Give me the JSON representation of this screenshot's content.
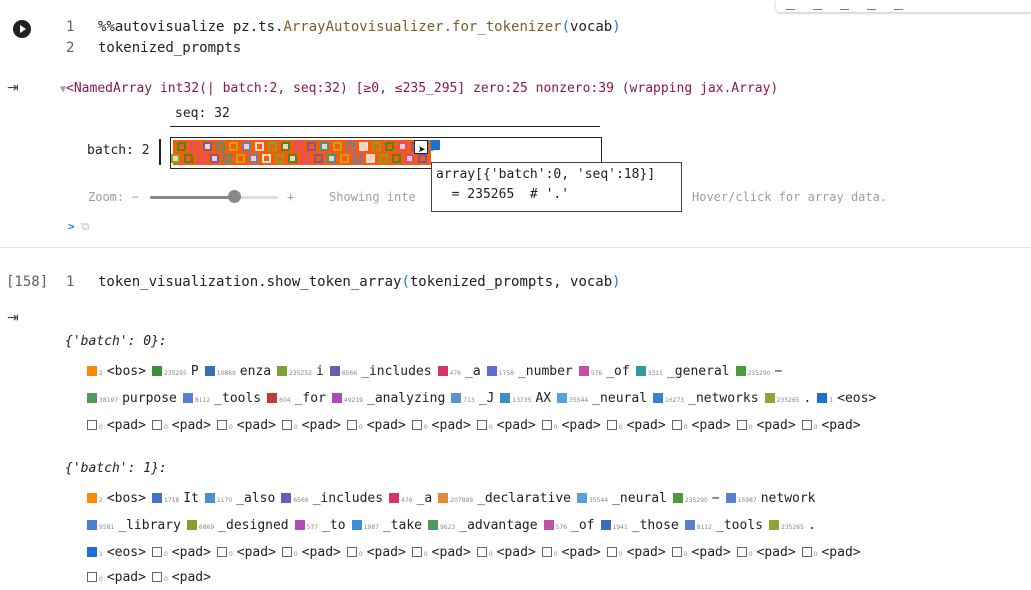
{
  "cell1": {
    "line_numbers": [
      "1",
      "2"
    ],
    "line1_prefix": "%%autovisualize pz.ts.",
    "line1_fn": "ArrayAutovisualizer.for_tokenizer",
    "line1_paren_open": "(",
    "line1_arg": "vocab",
    "line1_paren_close": ")",
    "line2": "tokenized_prompts"
  },
  "output1": {
    "named_array_summary": "<NamedArray int32(| batch:2, seq:32) [≥0, ≤235_295] zero:25 nonzero:39 (wrapping jax.Array)",
    "seq_label": "seq: 32",
    "batch_label": "batch: 2",
    "tooltip_line1": "array[{'batch':0, 'seq':18}]",
    "tooltip_line2": "  = 235265  # '.'",
    "zoom_label": "Zoom: −",
    "zoom_plus": "+",
    "showing_text": "Showing inte",
    "hover_text": "Hover/click for array data.",
    "expand_symbol": ">",
    "zoom_percent": 0.66
  },
  "cell2": {
    "exec_count": "[158]",
    "line_number": "1",
    "code_prefix": "token_visualization.show_token_array",
    "paren_open": "(",
    "code_args": "tokenized_prompts, vocab",
    "paren_close": ")"
  },
  "output2": {
    "batch0_header": "{'batch': 0}:",
    "batch1_header": "{'batch': 1}:",
    "batch0_lines": [
      [
        {
          "c": "#ff8a00",
          "id": "2",
          "t": "<bos>"
        },
        {
          "c": "#3d8f3d",
          "id": "235295",
          "t": "P"
        },
        {
          "c": "#3a6fb8",
          "id": "10869",
          "t": "enza"
        },
        {
          "c": "#7aa33a",
          "id": "235252",
          "t": "i"
        },
        {
          "c": "#6b5bb8",
          "id": "6566",
          "t": "_includes"
        },
        {
          "c": "#d6336c",
          "id": "476",
          "t": "_a"
        },
        {
          "c": "#5a6fd0",
          "id": "1758",
          "t": "_number"
        },
        {
          "c": "#c24fa8",
          "id": "576",
          "t": "_of"
        },
        {
          "c": "#2f9aa0",
          "id": "3311",
          "t": "_general"
        },
        {
          "c": "#4f9a3a",
          "id": "235290",
          "t": "−"
        }
      ],
      [
        {
          "c": "#4f9a5a",
          "id": "38197",
          "t": "purpose"
        },
        {
          "c": "#5a7fd0",
          "id": "8112",
          "t": "_tools"
        },
        {
          "c": "#c03a3a",
          "id": "604",
          "t": "_for"
        },
        {
          "c": "#b04ab8",
          "id": "49219",
          "t": "_analyzing"
        },
        {
          "c": "#5a8fd0",
          "id": "713",
          "t": "_J"
        },
        {
          "c": "#3a8fc8",
          "id": "13735",
          "t": "AX"
        },
        {
          "c": "#5a9fe0",
          "id": "35544",
          "t": "_neural"
        },
        {
          "c": "#3a7fd8",
          "id": "16273",
          "t": "_networks"
        },
        {
          "c": "#8fa33a",
          "id": "235265",
          "t": "."
        },
        {
          "c": "#1d6fd6",
          "id": "1",
          "t": "<eos>"
        }
      ],
      [
        {
          "c": "open",
          "id": "0",
          "t": "<pad>"
        },
        {
          "c": "open",
          "id": "0",
          "t": "<pad>"
        },
        {
          "c": "open",
          "id": "0",
          "t": "<pad>"
        },
        {
          "c": "open",
          "id": "0",
          "t": "<pad>"
        },
        {
          "c": "open",
          "id": "0",
          "t": "<pad>"
        },
        {
          "c": "open",
          "id": "0",
          "t": "<pad>"
        },
        {
          "c": "open",
          "id": "0",
          "t": "<pad>"
        },
        {
          "c": "open",
          "id": "0",
          "t": "<pad>"
        },
        {
          "c": "open",
          "id": "0",
          "t": "<pad>"
        },
        {
          "c": "open",
          "id": "0",
          "t": "<pad>"
        },
        {
          "c": "open",
          "id": "0",
          "t": "<pad>"
        },
        {
          "c": "open",
          "id": "0",
          "t": "<pad>"
        }
      ]
    ],
    "batch1_lines": [
      [
        {
          "c": "#ff8a00",
          "id": "2",
          "t": "<bos>"
        },
        {
          "c": "#4a6fd0",
          "id": "1718",
          "t": "It"
        },
        {
          "c": "#4a8fd0",
          "id": "1170",
          "t": "_also"
        },
        {
          "c": "#6b5bb8",
          "id": "6566",
          "t": "_includes"
        },
        {
          "c": "#d6336c",
          "id": "476",
          "t": "_a"
        },
        {
          "c": "#e08a3a",
          "id": "207899",
          "t": "_declarative"
        },
        {
          "c": "#5a9fe0",
          "id": "35544",
          "t": "_neural"
        },
        {
          "c": "#4f9a3a",
          "id": "235290",
          "t": "−"
        },
        {
          "c": "#5a7fd0",
          "id": "15987",
          "t": "network"
        }
      ],
      [
        {
          "c": "#4a7fd0",
          "id": "9581",
          "t": "_library"
        },
        {
          "c": "#8f9a2a",
          "id": "6869",
          "t": "_designed"
        },
        {
          "c": "#b04ab8",
          "id": "577",
          "t": "_to"
        },
        {
          "c": "#3a8fd8",
          "id": "1987",
          "t": "_take"
        },
        {
          "c": "#4f9a5a",
          "id": "9623",
          "t": "_advantage"
        },
        {
          "c": "#c24fa8",
          "id": "576",
          "t": "_of"
        },
        {
          "c": "#3a6fb8",
          "id": "1941",
          "t": "_those"
        },
        {
          "c": "#5a7fd0",
          "id": "8112",
          "t": "_tools"
        },
        {
          "c": "#8fa33a",
          "id": "235265",
          "t": "."
        }
      ],
      [
        {
          "c": "#1d6fd6",
          "id": "1",
          "t": "<eos>"
        },
        {
          "c": "open",
          "id": "0",
          "t": "<pad>"
        },
        {
          "c": "open",
          "id": "0",
          "t": "<pad>"
        },
        {
          "c": "open",
          "id": "0",
          "t": "<pad>"
        },
        {
          "c": "open",
          "id": "0",
          "t": "<pad>"
        },
        {
          "c": "open",
          "id": "0",
          "t": "<pad>"
        },
        {
          "c": "open",
          "id": "0",
          "t": "<pad>"
        },
        {
          "c": "open",
          "id": "0",
          "t": "<pad>"
        },
        {
          "c": "open",
          "id": "0",
          "t": "<pad>"
        },
        {
          "c": "open",
          "id": "0",
          "t": "<pad>"
        },
        {
          "c": "open",
          "id": "0",
          "t": "<pad>"
        },
        {
          "c": "open",
          "id": "0",
          "t": "<pad>"
        }
      ],
      [
        {
          "c": "open",
          "id": "0",
          "t": "<pad>"
        },
        {
          "c": "open",
          "id": "0",
          "t": "<pad>"
        }
      ]
    ]
  },
  "icons": {
    "run": "play-icon",
    "output_toggle": "output-collapse-icon"
  }
}
